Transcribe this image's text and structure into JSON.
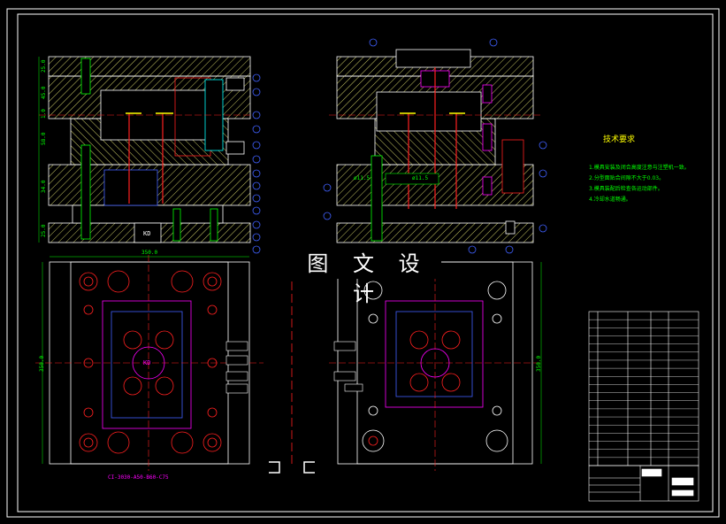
{
  "watermark": "图 文 设 计",
  "tech_requirements": {
    "title": "技术要求",
    "lines": [
      "1.模具安装及闭合高度注意与注塑机一致。",
      "2.分型面贴合间隙不大于0.03。",
      "3.模具装配后检查各运动部件。",
      "4.冷却水道畅通。"
    ]
  },
  "views": {
    "front_section_left": {
      "name": "left-section-view"
    },
    "front_section_right": {
      "name": "right-section-view"
    },
    "plan_left": {
      "name": "fixed-half-plan-view"
    },
    "plan_right": {
      "name": "moving-half-plan-view"
    }
  },
  "dimensions": {
    "plan_left_width": "350.0",
    "plan_left_height": "350.0",
    "plan_right_height": "350.0",
    "section_left_v": [
      "25.0",
      "45.0",
      "1.0",
      "58.0",
      "34.0",
      "25.0"
    ],
    "section_right_labels": [
      "ø11.5",
      "ø11.5"
    ]
  },
  "labels": {
    "kd_left": "KD",
    "kd_plan": "KD",
    "part_code": "CI-3030-A50-B60-C75"
  },
  "title_block": {
    "rows": 19
  },
  "colors": {
    "background": "#000000",
    "border": "#ffffff",
    "hatch": "#c8c864",
    "outline": "#ffffff",
    "red": "#ff2020",
    "yellow": "#ffff00",
    "green": "#00ff00",
    "blue": "#4060ff",
    "magenta": "#ff00ff",
    "cyan": "#00ffff"
  }
}
